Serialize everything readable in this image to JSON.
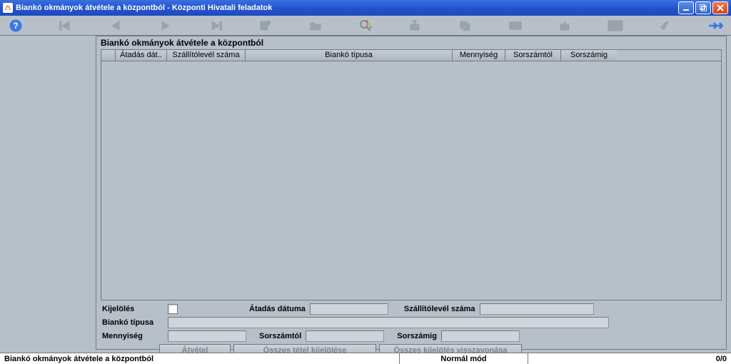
{
  "window": {
    "title": "Biankó okmányok átvétele a központból - Központi Hivatali feladatok"
  },
  "panel": {
    "title": "Biankó okmányok átvétele a központból"
  },
  "columns": {
    "checkbox": "",
    "atadas_dat": "Átadás dát..",
    "szallitolevel": "Szállítólevél száma",
    "bianko_tipusa": "Biankó típusa",
    "mennyiseg": "Mennyiség",
    "sorszamtol": "Sorszámtól",
    "sorszamig": "Sorszámig"
  },
  "form": {
    "kijeloles": "Kijelölés",
    "atadas_datuma": "Átadás dátuma",
    "szallitolevel_szama": "Szállítólevél száma",
    "bianko_tipusa": "Biankó típusa",
    "mennyiseg": "Mennyiség",
    "sorszamtol": "Sorszámtól",
    "sorszamig": "Sorszámig"
  },
  "buttons": {
    "atvetel": "Átvétel",
    "osszes_kijel": "Összes tétel kijelölése",
    "osszes_vissza": "Összes kijelölés visszavonása"
  },
  "status": {
    "left": "Biankó okmányok átvétele a központból",
    "mode": "Normál mód",
    "counter": "0/0"
  }
}
